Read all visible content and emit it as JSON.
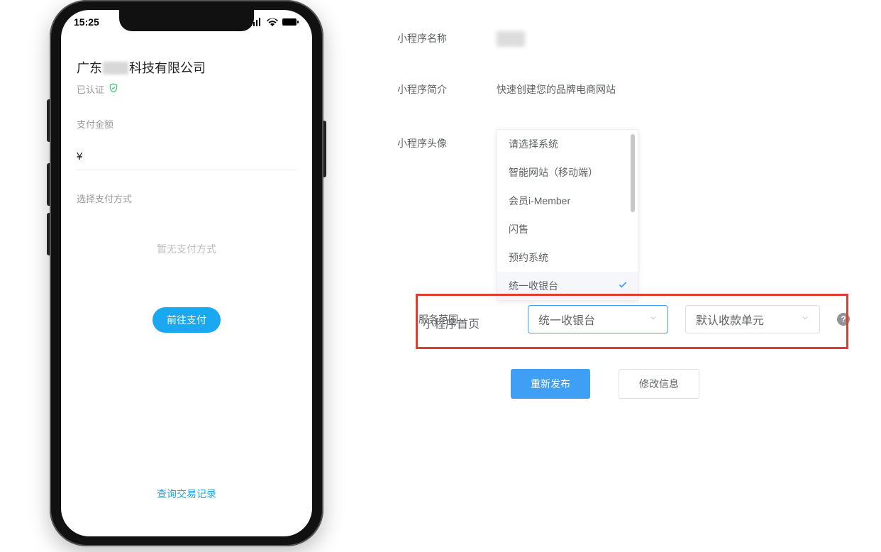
{
  "phone": {
    "time": "15:25",
    "company_prefix": "广东",
    "company_suffix": "科技有限公司",
    "cert_label": "已认证",
    "amount_label": "支付金额",
    "currency_symbol": "¥",
    "method_label": "选择支付方式",
    "no_method_text": "暂无支付方式",
    "pay_button_label": "前往支付",
    "query_link_label": "查询交易记录"
  },
  "form": {
    "name_label": "小程序名称",
    "desc_label": "小程序简介",
    "desc_value": "快速创建您的品牌电商网站",
    "avatar_label": "小程序头像",
    "scope_label": "服务范围",
    "home_label": "小程序首页"
  },
  "dropdown": {
    "options": {
      "0": "请选择系统",
      "1": "智能网站（移动端）",
      "2": "会员i-Member",
      "3": "闪售",
      "4": "预约系统",
      "5": "统一收银台"
    },
    "selected_value": "统一收银台"
  },
  "home_select": {
    "value": "统一收银台"
  },
  "unit_select": {
    "value": "默认收款单元"
  },
  "help_symbol": "?",
  "buttons": {
    "republish": "重新发布",
    "modify": "修改信息"
  }
}
